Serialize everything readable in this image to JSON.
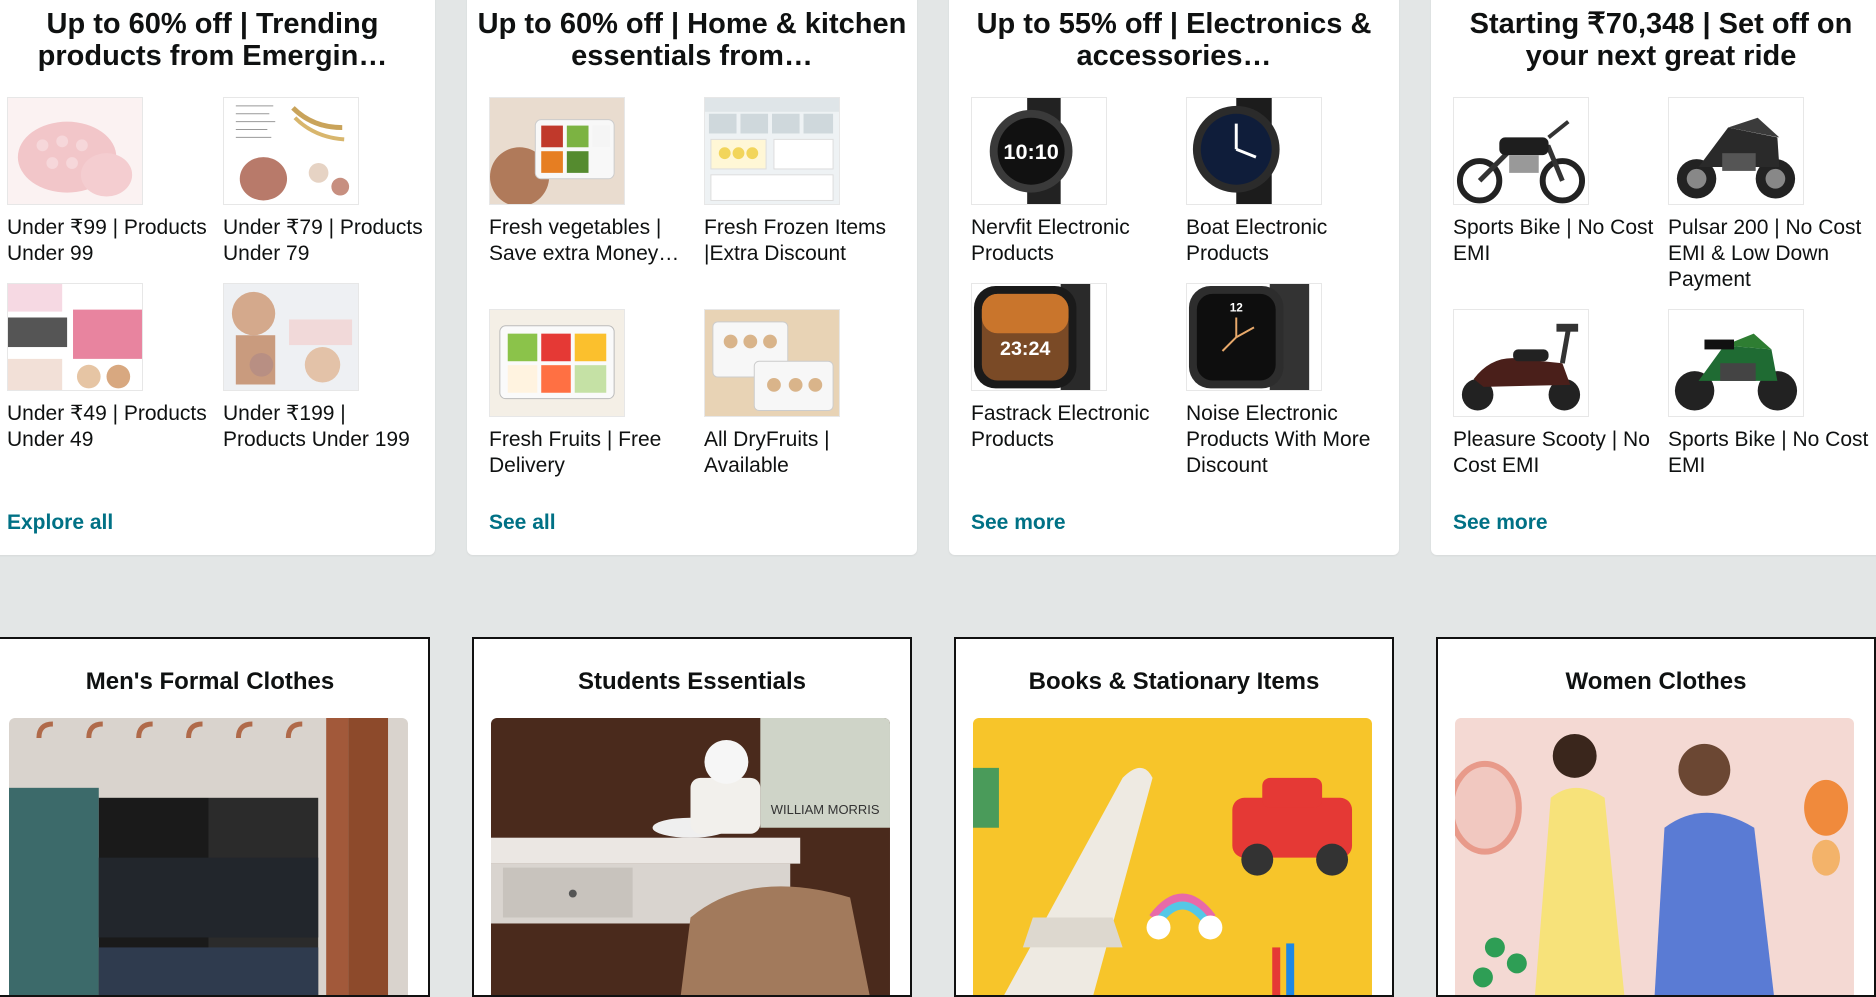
{
  "top_cards": [
    {
      "title": "Up to 60% off | Trending products from Emergin…",
      "link": "Explore all",
      "tiles": [
        {
          "label": "Under ₹99 | Products Under 99",
          "icon": "scalp-massager-image"
        },
        {
          "label": "Under ₹79 | Products Under 79",
          "icon": "hair-product-image"
        },
        {
          "label": "Under ₹49 | Products Under 49",
          "icon": "scalp-brush-image"
        },
        {
          "label": "Under ₹199 | Products Under 199",
          "icon": "hair-brush-image"
        }
      ]
    },
    {
      "title": "Up to 60% off | Home & kitchen essentials from…",
      "link": "See all",
      "tiles": [
        {
          "label": "Fresh vegetables | Save extra Money…",
          "icon": "vegetable-container-image"
        },
        {
          "label": "Fresh Frozen Items |Extra Discount",
          "icon": "fridge-containers-image"
        },
        {
          "label": "Fresh Fruits | Free Delivery",
          "icon": "fruit-container-image"
        },
        {
          "label": "All DryFruits | Available",
          "icon": "dryfruit-container-image"
        }
      ]
    },
    {
      "title": "Up to 55% off | Electronics & accessories…",
      "link": "See more",
      "tiles": [
        {
          "label": "Nervfit Electronic Products",
          "icon": "smartwatch-image"
        },
        {
          "label": "Boat Electronic Products",
          "icon": "smartwatch-image"
        },
        {
          "label": "Fastrack Electronic Products",
          "icon": "smartwatch-image"
        },
        {
          "label": "Noise Electronic Products With More Discount",
          "icon": "smartwatch-image"
        }
      ],
      "watch_faces": [
        "10:10",
        "",
        "23:24",
        "12"
      ]
    },
    {
      "title": "Starting ₹70,348 | Set off on your next great ride",
      "link": "See more",
      "tiles": [
        {
          "label": "Sports Bike | No Cost EMI",
          "icon": "motorcycle-image"
        },
        {
          "label": "Pulsar 200 | No Cost EMI & Low Down Payment",
          "icon": "motorcycle-image"
        },
        {
          "label": "Pleasure Scooty | No Cost EMI",
          "icon": "scooter-image"
        },
        {
          "label": "Sports Bike | No Cost EMI",
          "icon": "motorcycle-image"
        }
      ]
    }
  ],
  "bottom_cards": [
    {
      "title": "Men's Formal Clothes",
      "icon": "trouser-hanger-image"
    },
    {
      "title": "Students Essentials",
      "icon": "study-desk-image"
    },
    {
      "title": "Books & Stationary Items",
      "icon": "toys-stationery-image",
      "image_text": "WILLIAM MORRIS"
    },
    {
      "title": "Women Clothes",
      "icon": "women-fashion-image"
    }
  ],
  "colors": {
    "page_bg": "#e3e6e6",
    "card_bg": "#ffffff",
    "link": "#007185",
    "text": "#0f1111"
  }
}
